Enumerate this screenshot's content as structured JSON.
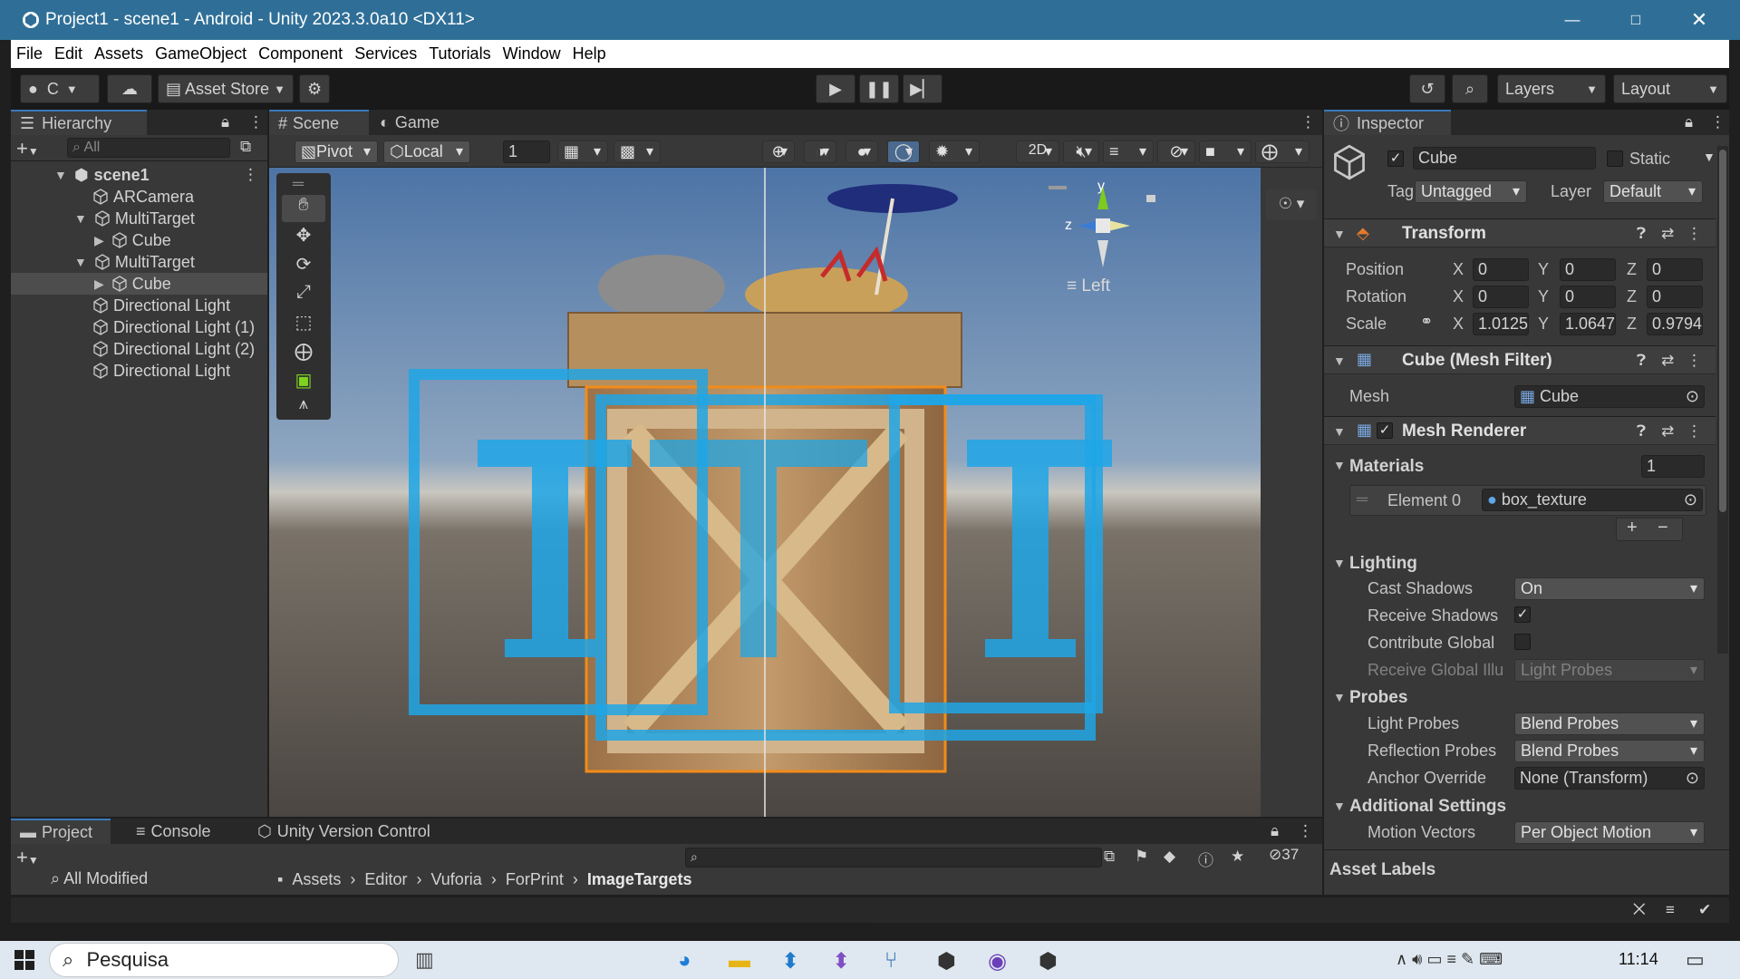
{
  "window": {
    "title": "Project1 - scene1 - Android - Unity 2023.3.0a10 <DX11>"
  },
  "menu": [
    "File",
    "Edit",
    "Assets",
    "GameObject",
    "Component",
    "Services",
    "Tutorials",
    "Window",
    "Help"
  ],
  "toolbar": {
    "account": "C",
    "asset_store": "Asset Store",
    "layers": "Layers",
    "layout": "Layout"
  },
  "hierarchy": {
    "tab": "Hierarchy",
    "search_placeholder": "All",
    "items": [
      {
        "label": "scene1"
      },
      {
        "label": "ARCamera"
      },
      {
        "label": "MultiTarget"
      },
      {
        "label": "Cube"
      },
      {
        "label": "MultiTarget"
      },
      {
        "label": "Cube"
      },
      {
        "label": "Directional Light"
      },
      {
        "label": "Directional Light (1)"
      },
      {
        "label": "Directional Light (2)"
      },
      {
        "label": "Directional Light"
      }
    ]
  },
  "scene": {
    "tab_scene": "Scene",
    "tab_game": "Game",
    "pivot": "Pivot",
    "local": "Local",
    "grid_value": "1",
    "mode_2d": "2D",
    "gizmo_y": "y",
    "gizmo_z": "z",
    "view_label": "Left"
  },
  "inspector": {
    "tab": "Inspector",
    "object_name": "Cube",
    "static_label": "Static",
    "tag_label": "Tag",
    "tag_value": "Untagged",
    "layer_label": "Layer",
    "layer_value": "Default",
    "transform": {
      "title": "Transform",
      "rows": [
        {
          "label": "Position",
          "x": "0",
          "y": "0",
          "z": "0"
        },
        {
          "label": "Rotation",
          "x": "0",
          "y": "0",
          "z": "0"
        },
        {
          "label": "Scale",
          "x": "1.0125",
          "y": "1.0647",
          "z": "0.9794"
        }
      ]
    },
    "mesh_filter": {
      "title": "Cube (Mesh Filter)",
      "mesh_label": "Mesh",
      "mesh_value": "Cube"
    },
    "mesh_renderer": {
      "title": "Mesh Renderer",
      "materials_label": "Materials",
      "materials_count": "1",
      "element_label": "Element 0",
      "element_value": "box_texture",
      "lighting_label": "Lighting",
      "cast_shadows_label": "Cast Shadows",
      "cast_shadows_value": "On",
      "receive_shadows_label": "Receive Shadows",
      "contribute_gi_label": "Contribute Global",
      "receive_gi_label": "Receive Global Illu",
      "receive_gi_value": "Light Probes",
      "probes_label": "Probes",
      "light_probes_label": "Light Probes",
      "light_probes_value": "Blend Probes",
      "reflection_probes_label": "Reflection Probes",
      "reflection_probes_value": "Blend Probes",
      "anchor_label": "Anchor Override",
      "anchor_value": "None (Transform)",
      "additional_label": "Additional Settings",
      "motion_label": "Motion Vectors",
      "motion_value": "Per Object Motion"
    },
    "asset_labels": "Asset Labels"
  },
  "project": {
    "tab_project": "Project",
    "tab_console": "Console",
    "tab_uvc": "Unity Version Control",
    "all_modified": "All Modified",
    "breadcrumb": [
      "Assets",
      "Editor",
      "Vuforia",
      "ForPrint",
      "ImageTargets"
    ],
    "hidden_count": "37"
  },
  "taskbar": {
    "search": "Pesquisa",
    "time": "11:14"
  },
  "colors": {
    "titlebar": "#2f6f97",
    "accent": "#3a79bb",
    "panel": "#383838",
    "scene_sky": "#5a7ea8",
    "target_blue": "#1ea6e6"
  }
}
